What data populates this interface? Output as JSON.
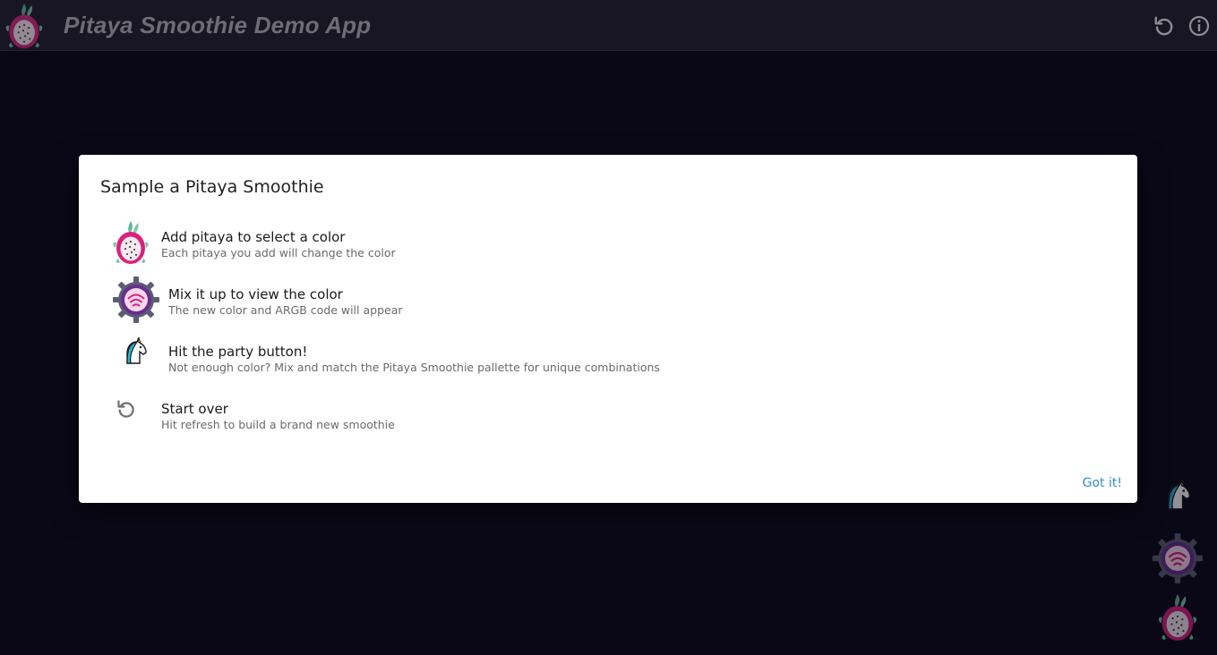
{
  "app": {
    "title": "Pitaya Smoothie Demo App"
  },
  "appbar": {
    "logo_icon": "pitaya-icon",
    "actions": [
      {
        "name": "refresh",
        "icon": "refresh-icon"
      },
      {
        "name": "info",
        "icon": "info-icon"
      }
    ]
  },
  "dialog": {
    "title": "Sample a Pitaya Smoothie",
    "steps": [
      {
        "icon": "pitaya-icon",
        "title": "Add pitaya to select a color",
        "subtitle": "Each pitaya you add will change the color"
      },
      {
        "icon": "mixer-icon",
        "title": "Mix it up to view the color",
        "subtitle": "The new color and ARGB code will appear"
      },
      {
        "icon": "unicorn-icon",
        "title": "Hit the party button!",
        "subtitle": "Not enough color? Mix and match the Pitaya Smoothie pallette for unique combinations"
      },
      {
        "icon": "refresh-icon",
        "title": "Start over",
        "subtitle": "Hit refresh to build a brand new smoothie"
      }
    ],
    "action_label": "Got it!"
  },
  "fabs": [
    {
      "name": "party",
      "icon": "unicorn-icon"
    },
    {
      "name": "mix",
      "icon": "mixer-icon"
    },
    {
      "name": "add-pitaya",
      "icon": "pitaya-icon"
    }
  ],
  "colors": {
    "background": "#0a0817",
    "appbar": "#171622",
    "accent": "#2e8fc9",
    "pitaya_pink": "#e0368a",
    "mixer_purple": "#6a2d8f"
  }
}
